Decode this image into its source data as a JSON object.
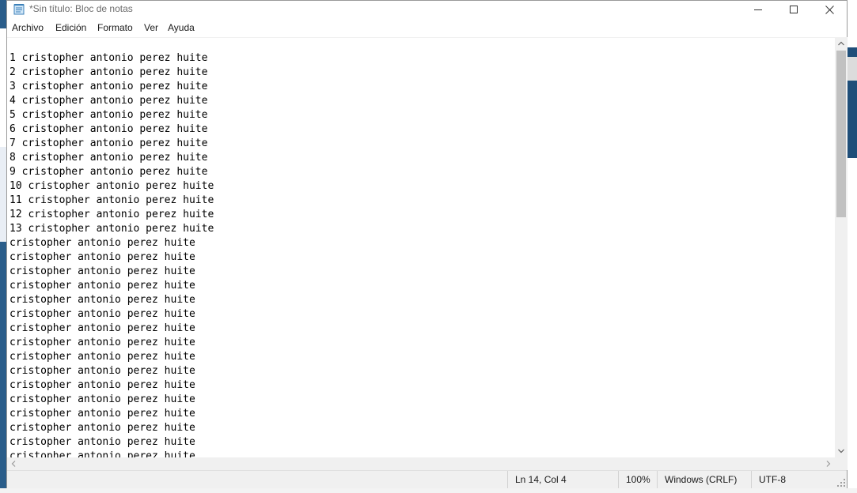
{
  "window": {
    "title": "*Sin título: Bloc de notas"
  },
  "menu": {
    "items": [
      "Archivo",
      "Edición",
      "Formato",
      "Ver",
      "Ayuda"
    ]
  },
  "editor": {
    "lines": [
      "1 cristopher antonio perez huite",
      "2 cristopher antonio perez huite",
      "3 cristopher antonio perez huite",
      "4 cristopher antonio perez huite",
      "5 cristopher antonio perez huite",
      "6 cristopher antonio perez huite",
      "7 cristopher antonio perez huite",
      "8 cristopher antonio perez huite",
      "9 cristopher antonio perez huite",
      "10 cristopher antonio perez huite",
      "11 cristopher antonio perez huite",
      "12 cristopher antonio perez huite",
      "13 cristopher antonio perez huite",
      "cristopher antonio perez huite",
      "cristopher antonio perez huite",
      "cristopher antonio perez huite",
      "cristopher antonio perez huite",
      "cristopher antonio perez huite",
      "cristopher antonio perez huite",
      "cristopher antonio perez huite",
      "cristopher antonio perez huite",
      "cristopher antonio perez huite",
      "cristopher antonio perez huite",
      "cristopher antonio perez huite",
      "cristopher antonio perez huite",
      "cristopher antonio perez huite",
      "cristopher antonio perez huite",
      "cristopher antonio perez huite",
      "cristopher antonio perez huite"
    ]
  },
  "statusbar": {
    "position": "Ln 14, Col 4",
    "zoom": "100%",
    "line_ending": "Windows (CRLF)",
    "encoding": "UTF-8"
  },
  "icons": {
    "app": "notepad-icon",
    "minimize": "minimize-icon",
    "maximize": "maximize-icon",
    "close": "close-icon"
  },
  "colors": {
    "background_window": "#1f4e79",
    "title_text": "#6d6d6d",
    "statusbar_bg": "#f0f0f0"
  }
}
